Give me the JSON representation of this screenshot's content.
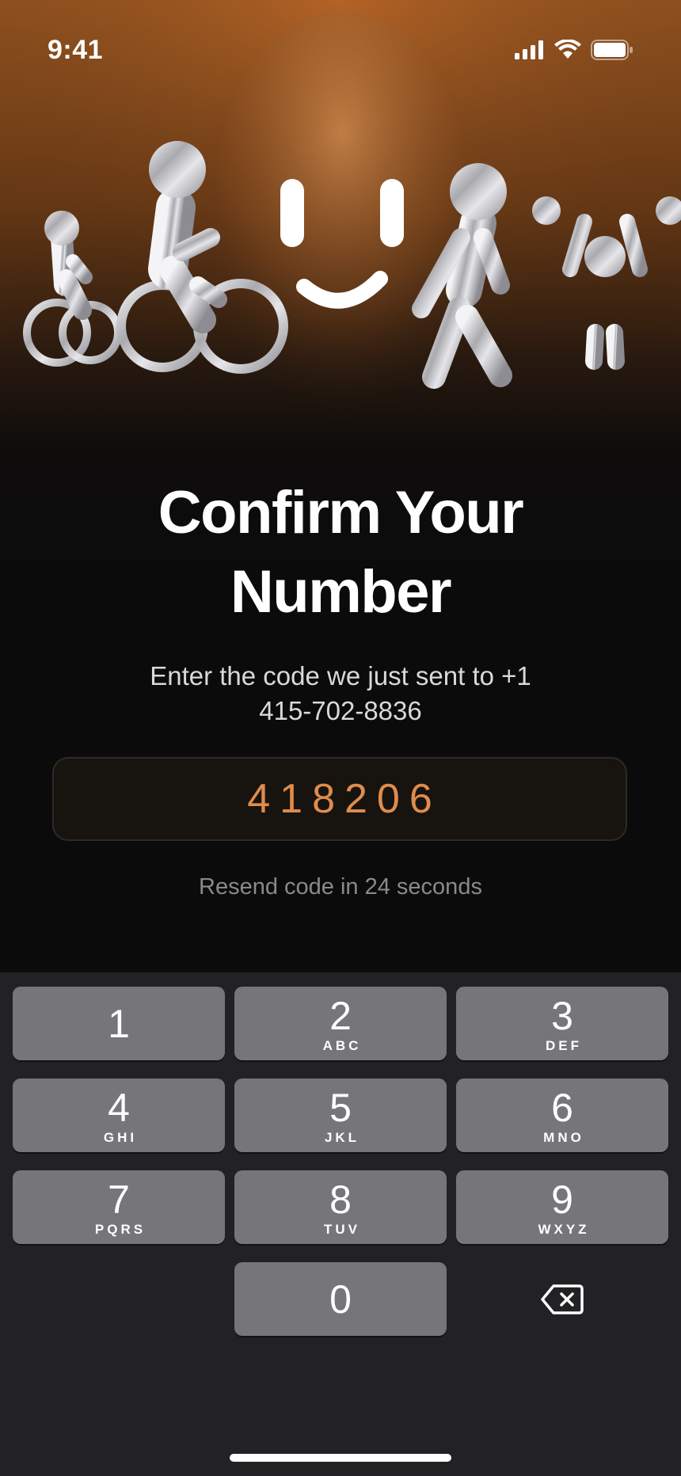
{
  "status_bar": {
    "time": "9:41",
    "icons": [
      "cellular-signal-icon",
      "wifi-icon",
      "battery-icon"
    ]
  },
  "hero": {
    "illustration": "smiley-face-with-athletes-illustration",
    "icons": [
      "smiley-face-icon",
      "cyclist-icon",
      "wheelchair-athlete-icon",
      "walker-icon",
      "weightlifter-icon"
    ]
  },
  "title": {
    "line1": "Confirm Your",
    "line2": "Number"
  },
  "subtitle": {
    "line1": "Enter the code we just sent to +1",
    "line2": "415-702-8836"
  },
  "code_field": {
    "value": "418206"
  },
  "resend": {
    "text": "Resend code in 24 seconds"
  },
  "keypad": {
    "keys": [
      {
        "digit": "1",
        "letters": ""
      },
      {
        "digit": "2",
        "letters": "ABC"
      },
      {
        "digit": "3",
        "letters": "DEF"
      },
      {
        "digit": "4",
        "letters": "GHI"
      },
      {
        "digit": "5",
        "letters": "JKL"
      },
      {
        "digit": "6",
        "letters": "MNO"
      },
      {
        "digit": "7",
        "letters": "PQRS"
      },
      {
        "digit": "8",
        "letters": "TUV"
      },
      {
        "digit": "9",
        "letters": "WXYZ"
      },
      {
        "digit": "0",
        "letters": ""
      }
    ],
    "backspace_icon": "backspace-icon"
  },
  "colors": {
    "accent": "#e08c4c",
    "background": "#0b0b0c",
    "keypad_background": "#222124",
    "key": "#767579"
  }
}
